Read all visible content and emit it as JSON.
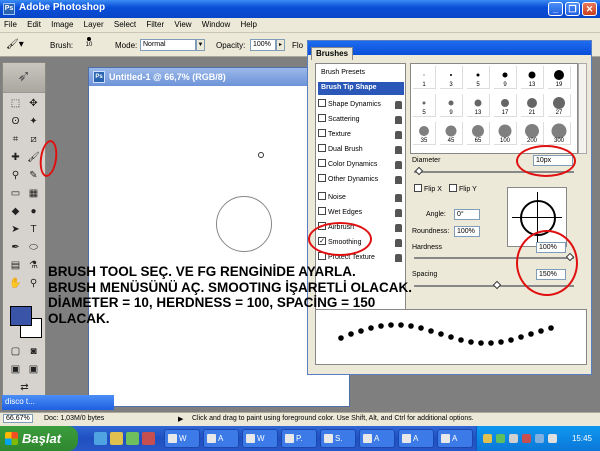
{
  "window": {
    "title": "Adobe Photoshop",
    "icon_label": "Ps"
  },
  "menu": [
    "File",
    "Edit",
    "Image",
    "Layer",
    "Select",
    "Filter",
    "View",
    "Window",
    "Help"
  ],
  "options_bar": {
    "brush_label": "Brush:",
    "brush_size": "10",
    "mode_label": "Mode:",
    "mode_value": "Normal",
    "opacity_label": "Opacity:",
    "opacity_value": "100%",
    "flow_label": "Flo"
  },
  "document": {
    "title": "Untitled-1 @ 66,7% (RGB/8)"
  },
  "brushes_panel": {
    "tab_label": "Brushes",
    "presets_label": "Brush Presets",
    "tip_shape_label": "Brush Tip Shape",
    "options": [
      {
        "label": "Shape Dynamics",
        "checked": false
      },
      {
        "label": "Scattering",
        "checked": false
      },
      {
        "label": "Texture",
        "checked": false
      },
      {
        "label": "Dual Brush",
        "checked": false
      },
      {
        "label": "Color Dynamics",
        "checked": false
      },
      {
        "label": "Other Dynamics",
        "checked": false
      },
      {
        "label": "Noise",
        "checked": false
      },
      {
        "label": "Wet Edges",
        "checked": false
      },
      {
        "label": "Airbrush",
        "checked": false
      },
      {
        "label": "Smoothing",
        "checked": true
      },
      {
        "label": "Protect Texture",
        "checked": false
      }
    ],
    "tip_sizes_row1": [
      "1",
      "3",
      "5",
      "9",
      "13",
      "19"
    ],
    "tip_sizes_row2": [
      "5",
      "9",
      "13",
      "17",
      "21",
      "27"
    ],
    "tip_sizes_row3": [
      "35",
      "45",
      "65",
      "100",
      "200",
      "300"
    ],
    "diameter_label": "Diameter",
    "diameter_value": "10px",
    "flip_x_label": "Flip X",
    "flip_y_label": "Flip Y",
    "angle_label": "Angle:",
    "angle_value": "0°",
    "roundness_label": "Roundness:",
    "roundness_value": "100%",
    "hardness_label": "Hardness",
    "hardness_value": "100%",
    "spacing_label": "Spacing",
    "spacing_value": "150%"
  },
  "overlay_instructions": "BRUSH TOOL SEÇ. VE FG RENGİNİDE AYARLA.\nBRUSH MENÜSÜNÜ AÇ. SMOOTING İŞARETLİ OLACAK.\nDİAMETER = 10, HERDNESS = 100, SPACİNG = 150\nOLACAK.",
  "mini_doc_title": "disco t...",
  "status_bar": {
    "zoom": "66.67%",
    "doc_info": "Doc: 1,03M/0 bytes",
    "hint": "Click and drag to paint using foreground color.  Use Shift, Alt, and Ctrl for additional options."
  },
  "taskbar": {
    "start_label": "Başlat",
    "tasks": [
      "W",
      "A",
      "W",
      "P.",
      "S.",
      "A",
      "A",
      "A"
    ],
    "clock": "15:45"
  },
  "colors": {
    "foreground": "#3a55a8",
    "annotation_red": "#e01010"
  }
}
